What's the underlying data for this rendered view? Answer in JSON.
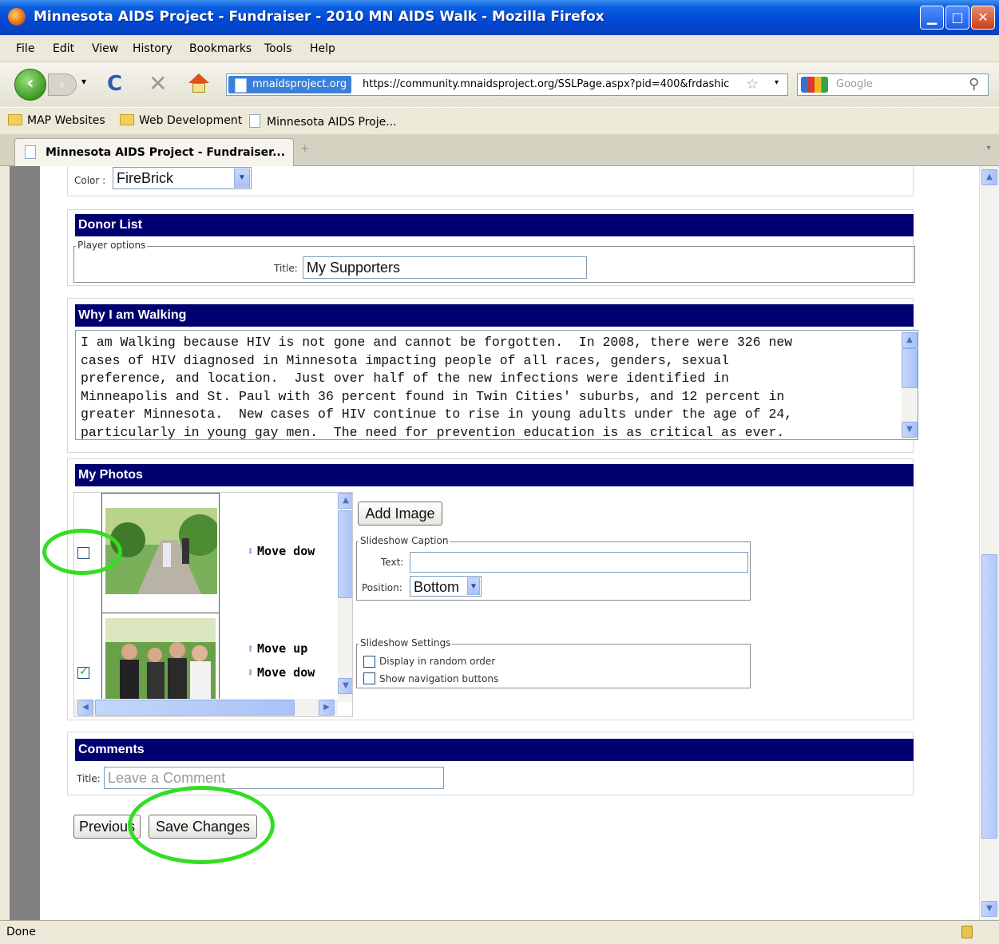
{
  "window": {
    "title": "Minnesota AIDS Project - Fundraiser - 2010 MN AIDS Walk - Mozilla Firefox"
  },
  "menu": [
    "File",
    "Edit",
    "View",
    "History",
    "Bookmarks",
    "Tools",
    "Help"
  ],
  "nav": {
    "site_identity": "mnaidsproject.org",
    "url": "https://community.mnaidsproject.org/SSLPage.aspx?pid=400&frdashic",
    "search_placeholder": "Google"
  },
  "bookmarks": [
    "MAP Websites",
    "Web Development",
    "Minnesota AIDS Proje..."
  ],
  "tab": {
    "label": "Minnesota AIDS Project - Fundraiser..."
  },
  "color_section": {
    "label": "Color :",
    "value": "FireBrick"
  },
  "donor_list": {
    "header": "Donor List",
    "legend": "Player options",
    "title_label": "Title:",
    "title_value": "My Supporters"
  },
  "why_walking": {
    "header": "Why I am Walking",
    "lines": [
      "I am Walking because HIV is not gone and cannot be forgotten.  In 2008, there were 326 new",
      "cases of HIV diagnosed in Minnesota impacting people of all races, genders, sexual",
      "preference, and location.  Just over half of the new infections were identified in",
      "Minneapolis and St. Paul with 36 percent found in Twin Cities' suburbs, and 12 percent in",
      "greater Minnesota.  New cases of HIV continue to rise in young adults under the age of 24,",
      "particularly in young gay men.  The need for prevention education is as critical as ever."
    ]
  },
  "photos": {
    "header": "My Photos",
    "add_image": "Add Image",
    "move_down": "Move dow",
    "move_up": "Move up",
    "row1_checked": false,
    "row2_checked": true,
    "caption_legend": "Slideshow Caption",
    "text_label": "Text:",
    "text_value": "",
    "position_label": "Position:",
    "position_value": "Bottom",
    "settings_legend": "Slideshow Settings",
    "random_order": "Display in random order",
    "nav_buttons": "Show navigation buttons"
  },
  "comments": {
    "header": "Comments",
    "title_label": "Title:",
    "title_placeholder": "Leave a Comment"
  },
  "footer_buttons": {
    "previous": "Previous",
    "save": "Save Changes"
  },
  "status": {
    "text": "Done"
  },
  "colors": {
    "section_header": "#000070",
    "highlight_ring": "#33dd22"
  }
}
